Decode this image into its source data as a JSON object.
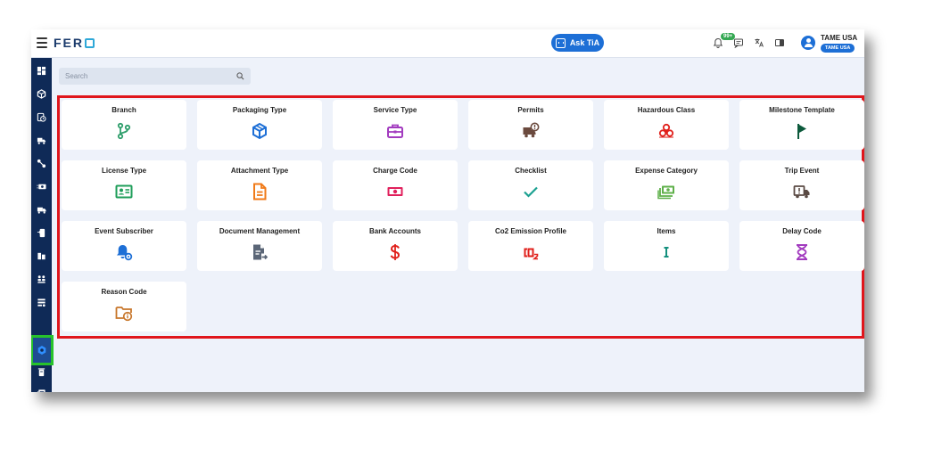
{
  "app": {
    "logo_text": "FER",
    "ask_label": "Ask TiA",
    "notification_count": "99+",
    "user_name": "TAME USA",
    "user_chip": "TAME USA"
  },
  "search": {
    "placeholder": "Search"
  },
  "cards": [
    {
      "label": "Branch",
      "icon": "branch-icon",
      "color": "#2e9e6b"
    },
    {
      "label": "Packaging Type",
      "icon": "box-icon",
      "color": "#1d6fd6"
    },
    {
      "label": "Service Type",
      "icon": "toolbox-icon",
      "color": "#a23bbf"
    },
    {
      "label": "Permits",
      "icon": "truck-alert-icon",
      "color": "#6b4a3e"
    },
    {
      "label": "Hazardous Class",
      "icon": "biohazard-icon",
      "color": "#e0201b"
    },
    {
      "label": "Milestone Template",
      "icon": "flag-icon",
      "color": "#0d5a3c"
    },
    {
      "label": "License Type",
      "icon": "id-card-icon",
      "color": "#1f9e5a"
    },
    {
      "label": "Attachment Type",
      "icon": "document-icon",
      "color": "#f07a18"
    },
    {
      "label": "Charge Code",
      "icon": "money-icon",
      "color": "#e0205c"
    },
    {
      "label": "Checklist",
      "icon": "check-icon",
      "color": "#1aa090"
    },
    {
      "label": "Expense Category",
      "icon": "cash-stack-icon",
      "color": "#5fb04a"
    },
    {
      "label": "Trip Event",
      "icon": "truck-event-icon",
      "color": "#5a4a44"
    },
    {
      "label": "Event Subscriber",
      "icon": "bell-gear-icon",
      "color": "#1d6fd6"
    },
    {
      "label": "Document Management",
      "icon": "file-arrow-icon",
      "color": "#5b6677"
    },
    {
      "label": "Bank Accounts",
      "icon": "dollar-icon",
      "color": "#e0201b"
    },
    {
      "label": "Co2 Emission Profile",
      "icon": "co2-icon",
      "color": "#e0201b"
    },
    {
      "label": "Items",
      "icon": "text-cursor-icon",
      "color": "#14907e"
    },
    {
      "label": "Delay Code",
      "icon": "hourglass-icon",
      "color": "#a23bbf"
    },
    {
      "label": "Reason Code",
      "icon": "folder-info-icon",
      "color": "#c8762a"
    }
  ],
  "colors": {
    "sidebar": "#0f2a57",
    "accent": "#1d6fd6",
    "highlight_red": "#e0161c",
    "highlight_green": "#27c22b"
  }
}
